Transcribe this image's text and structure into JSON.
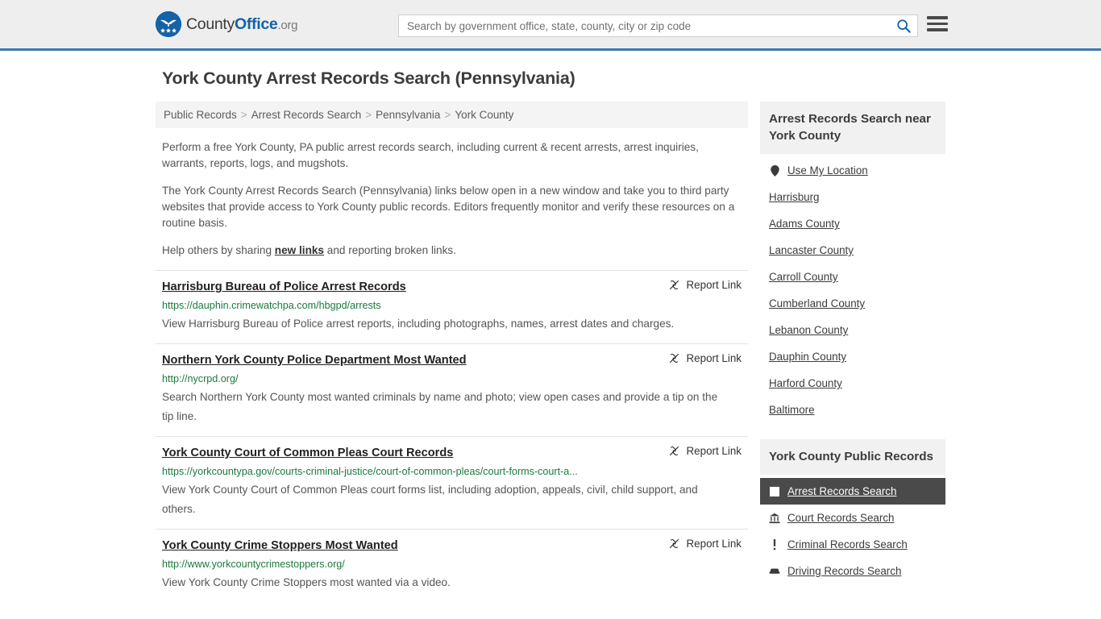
{
  "header": {
    "logo": {
      "part1": "County",
      "part2": "Office",
      "part3": ".org",
      "icon": "eagle-shield-icon"
    },
    "search": {
      "placeholder": "Search by government office, state, county, city or zip code",
      "value": ""
    },
    "search_icon": "search-icon",
    "menu_icon": "hamburger-menu-icon",
    "accent_color": "#1462a8",
    "border_color": "#3a7ab0"
  },
  "page": {
    "title": "York County Arrest Records Search (Pennsylvania)"
  },
  "breadcrumb": {
    "items": [
      {
        "label": "Public Records"
      },
      {
        "label": "Arrest Records Search"
      },
      {
        "label": "Pennsylvania"
      },
      {
        "label": "York County"
      }
    ],
    "separator": ">"
  },
  "intro": {
    "p1": "Perform a free York County, PA public arrest records search, including current & recent arrests, arrest inquiries, warrants, reports, logs, and mugshots.",
    "p2": "The York County Arrest Records Search (Pennsylvania) links below open in a new window and take you to third party websites that provide access to York County public records. Editors frequently monitor and verify these resources on a routine basis.",
    "p3_before": "Help others by sharing ",
    "p3_link": "new links",
    "p3_after": " and reporting broken links."
  },
  "results": {
    "report_label": "Report Link",
    "report_icon": "broken-link-icon",
    "items": [
      {
        "title": "Harrisburg Bureau of Police Arrest Records",
        "url": "https://dauphin.crimewatchpa.com/hbgpd/arrests",
        "description": "View Harrisburg Bureau of Police arrest reports, including photographs, names, arrest dates and charges."
      },
      {
        "title": "Northern York County Police Department Most Wanted",
        "url": "http://nycrpd.org/",
        "description": "Search Northern York County most wanted criminals by name and photo; view open cases and provide a tip on the tip line."
      },
      {
        "title": "York County Court of Common Pleas Court Records",
        "url": "https://yorkcountypa.gov/courts-criminal-justice/court-of-common-pleas/court-forms-court-a...",
        "description": "View York County Court of Common Pleas court forms list, including adoption, appeals, civil, child support, and others."
      },
      {
        "title": "York County Crime Stoppers Most Wanted",
        "url": "http://www.yorkcountycrimestoppers.org/",
        "description": "View York County Crime Stoppers most wanted via a video."
      }
    ]
  },
  "sidebar": {
    "nearby": {
      "title": "Arrest Records Search near York County",
      "items": [
        {
          "label": "Use My Location",
          "icon": "map-pin-icon"
        },
        {
          "label": "Harrisburg",
          "icon": ""
        },
        {
          "label": "Adams County",
          "icon": ""
        },
        {
          "label": "Lancaster County",
          "icon": ""
        },
        {
          "label": "Carroll County",
          "icon": ""
        },
        {
          "label": "Cumberland County",
          "icon": ""
        },
        {
          "label": "Lebanon County",
          "icon": ""
        },
        {
          "label": "Dauphin County",
          "icon": ""
        },
        {
          "label": "Harford County",
          "icon": ""
        },
        {
          "label": "Baltimore",
          "icon": ""
        }
      ]
    },
    "public_records": {
      "title": "York County Public Records",
      "items": [
        {
          "label": "Arrest Records Search",
          "icon": "square-icon",
          "active": true
        },
        {
          "label": "Court Records Search",
          "icon": "courthouse-icon",
          "active": false
        },
        {
          "label": "Criminal Records Search",
          "icon": "exclamation-icon",
          "active": false
        },
        {
          "label": "Driving Records Search",
          "icon": "car-icon",
          "active": false
        }
      ]
    }
  }
}
